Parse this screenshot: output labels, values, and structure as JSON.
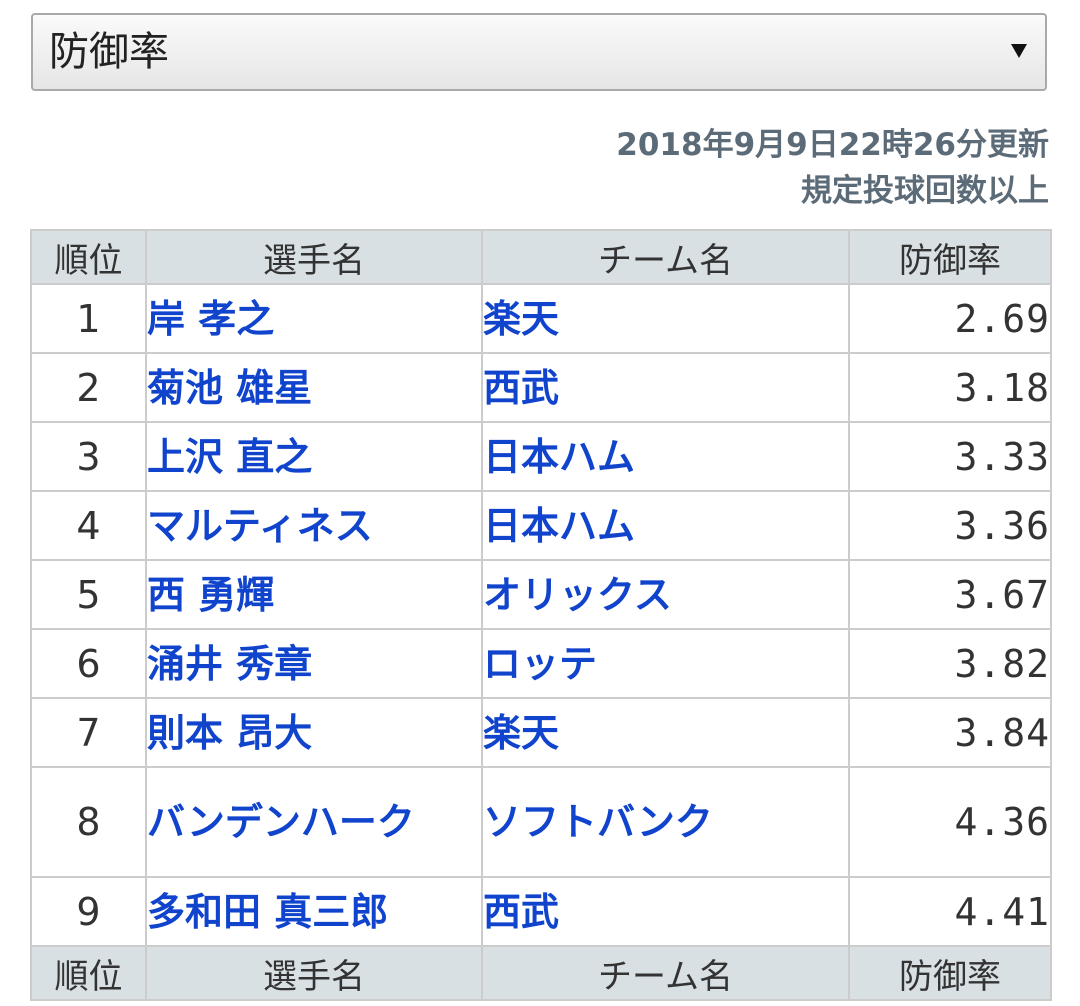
{
  "selector": {
    "selected": "防御率"
  },
  "update": {
    "timestamp": "2018年9月9日22時26分更新",
    "note": "規定投球回数以上"
  },
  "table": {
    "headers": [
      "順位",
      "選手名",
      "チーム名",
      "防御率"
    ],
    "rows": [
      {
        "rank": "1",
        "player": "岸 孝之",
        "team": "楽天",
        "era": "2.69"
      },
      {
        "rank": "2",
        "player": "菊池 雄星",
        "team": "西武",
        "era": "3.18"
      },
      {
        "rank": "3",
        "player": "上沢 直之",
        "team": "日本ハム",
        "era": "3.33"
      },
      {
        "rank": "4",
        "player": "マルティネス",
        "team": "日本ハム",
        "era": "3.36"
      },
      {
        "rank": "5",
        "player": "西 勇輝",
        "team": "オリックス",
        "era": "3.67"
      },
      {
        "rank": "6",
        "player": "涌井 秀章",
        "team": "ロッテ",
        "era": "3.82"
      },
      {
        "rank": "7",
        "player": "則本 昂大",
        "team": "楽天",
        "era": "3.84"
      },
      {
        "rank": "8",
        "player": "バンデンハーク",
        "team": "ソフトバンク",
        "era": "4.36"
      },
      {
        "rank": "9",
        "player": "多和田 真三郎",
        "team": "西武",
        "era": "4.41"
      }
    ]
  },
  "colors": {
    "link": "#1144cc",
    "header_bg": "#d8e0e4",
    "update_text": "#5c6b78"
  }
}
